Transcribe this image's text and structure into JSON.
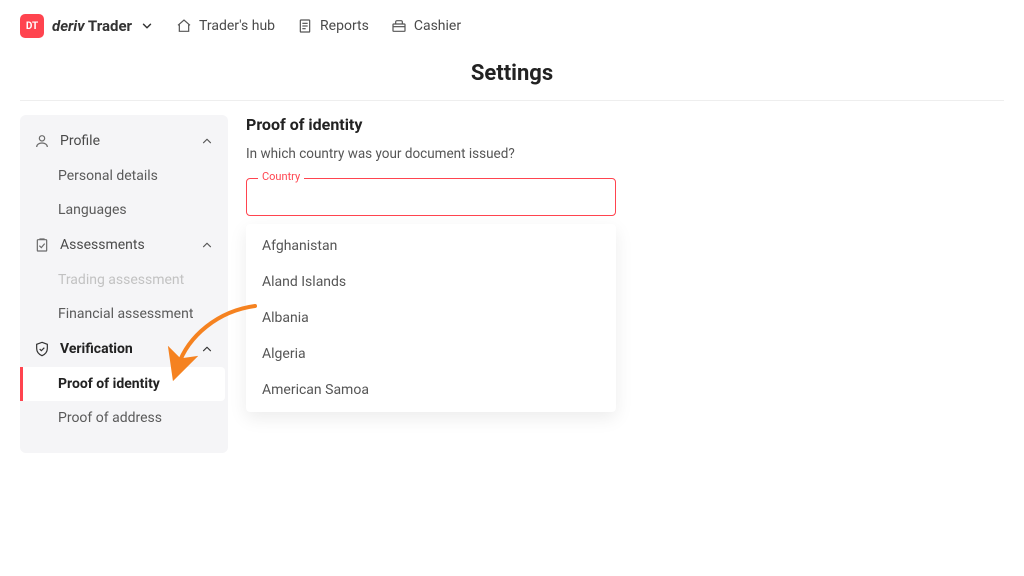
{
  "brand": {
    "badge": "DT",
    "name_italic": "deriv",
    "name_bold": " Trader"
  },
  "topnav": {
    "items": [
      {
        "label": "Trader's hub"
      },
      {
        "label": "Reports"
      },
      {
        "label": "Cashier"
      }
    ]
  },
  "page": {
    "title": "Settings"
  },
  "sidebar": {
    "sections": [
      {
        "label": "Profile",
        "items": [
          {
            "label": "Personal details"
          },
          {
            "label": "Languages"
          }
        ]
      },
      {
        "label": "Assessments",
        "items": [
          {
            "label": "Trading assessment",
            "disabled": true
          },
          {
            "label": "Financial assessment"
          }
        ]
      },
      {
        "label": "Verification",
        "bold": true,
        "items": [
          {
            "label": "Proof of identity",
            "active": true
          },
          {
            "label": "Proof of address"
          }
        ]
      }
    ]
  },
  "main": {
    "heading": "Proof of identity",
    "question": "In which country was your document issued?",
    "field_label": "Country",
    "field_value": "",
    "dropdown": [
      "Afghanistan",
      "Aland Islands",
      "Albania",
      "Algeria",
      "American Samoa"
    ]
  },
  "colors": {
    "accent": "#ff444f",
    "arrow": "#f58220"
  }
}
